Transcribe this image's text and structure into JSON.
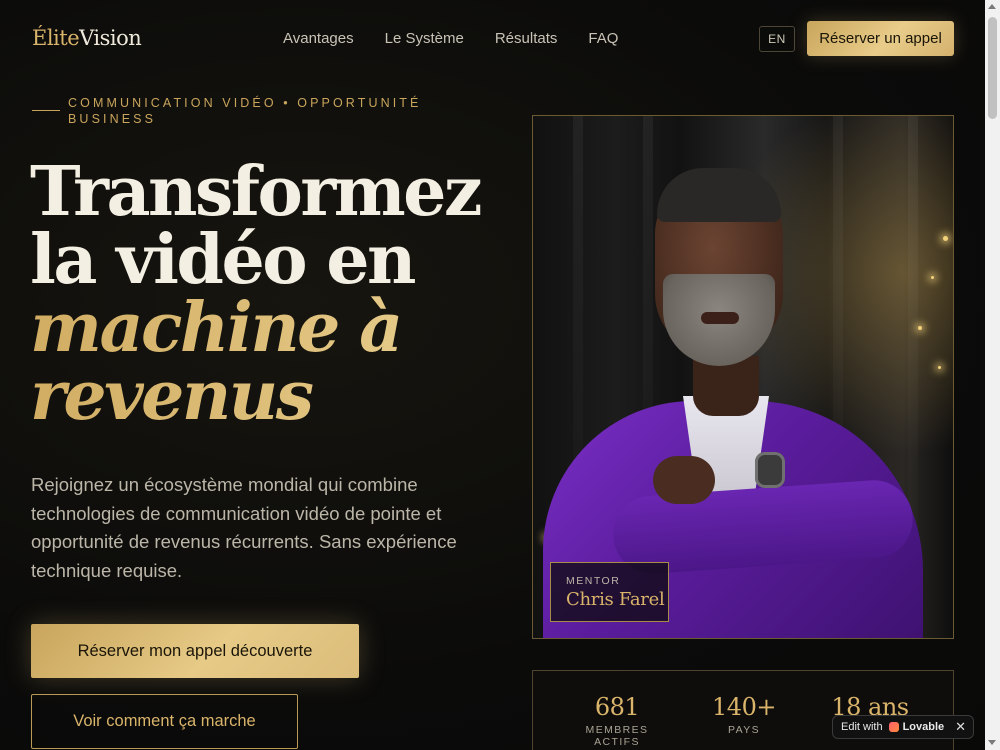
{
  "nav": {
    "logo_part1": "Élite",
    "logo_part2": "Vision",
    "links": [
      "Avantages",
      "Le Système",
      "Résultats",
      "FAQ"
    ],
    "lang": "EN",
    "cta": "Réserver un appel"
  },
  "hero": {
    "eyebrow": "COMMUNICATION VIDÉO • OPPORTUNITÉ BUSINESS",
    "headline_line1": "Transformez",
    "headline_line2": "la vidéo en",
    "headline_line3": "machine à",
    "headline_line4": "revenus",
    "lead": "Rejoignez un écosystème mondial qui combine technologies de communication vidéo de pointe et opportunité de revenus récurrents. Sans expérience technique requise.",
    "primary_button": "Réserver mon appel découverte",
    "secondary_button": "Voir comment ça marche"
  },
  "portrait": {
    "role": "MENTOR",
    "name": "Chris Farel"
  },
  "stats": [
    {
      "value": "681",
      "label": "MEMBRES ACTIFS"
    },
    {
      "value": "140+",
      "label": "PAYS"
    },
    {
      "value": "18 ans",
      "label": ""
    }
  ],
  "badge": {
    "edit_with": "Edit with",
    "brand": "Lovable",
    "close": "✕"
  },
  "colors": {
    "gold": "#d9b46a",
    "background": "#0b0b0a",
    "suit_purple": "#5a1c9c"
  }
}
